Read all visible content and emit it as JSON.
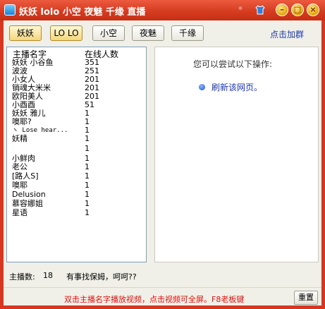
{
  "window": {
    "title": "妖妖 lolo 小空 夜魅 千缘 直播",
    "controls": {
      "minimize": "–",
      "maximize": "□",
      "close": "×"
    }
  },
  "tabs": [
    {
      "label": "妖妖",
      "active": true
    },
    {
      "label": "LO LO",
      "active": true
    },
    {
      "label": "小空",
      "active": false
    },
    {
      "label": "夜魅",
      "active": false
    },
    {
      "label": "千缘",
      "active": false
    }
  ],
  "top_link": "点击加群",
  "list": {
    "headers": {
      "name": "主播名字",
      "count": "在线人数"
    },
    "rows": [
      {
        "name": "妖妖 小谷鱼",
        "count": "351"
      },
      {
        "name": "波波",
        "count": "251"
      },
      {
        "name": "小女人",
        "count": "201"
      },
      {
        "name": "销魂大米米",
        "count": "201"
      },
      {
        "name": "欧阳美人",
        "count": "201"
      },
      {
        "name": "小酉酉",
        "count": "51"
      },
      {
        "name": "妖妖 雅儿",
        "count": "1"
      },
      {
        "name": "噢耶?",
        "count": "1"
      },
      {
        "name": "ヽ Lose hear...",
        "count": "1"
      },
      {
        "name": "妖精",
        "count": "1"
      },
      {
        "name": "",
        "count": "1"
      },
      {
        "name": "小鲜肉",
        "count": "1"
      },
      {
        "name": "老公",
        "count": "1"
      },
      {
        "name": "[路人S]",
        "count": "1"
      },
      {
        "name": "噢耶",
        "count": "1"
      },
      {
        "name": "Delusion",
        "count": "1"
      },
      {
        "name": "慕容娜姐",
        "count": "1"
      },
      {
        "name": "星语",
        "count": "1"
      }
    ]
  },
  "right_panel": {
    "message": "您可以尝试以下操作:",
    "link": "刷新该网页。"
  },
  "status": {
    "label": "主播数:",
    "value": "18",
    "tip": "有事找保姆，呵呵??"
  },
  "bottom": {
    "notice": "双击主播名字播放视频，点击视频可全屏。F8老板键",
    "reset_button": "重置"
  },
  "colors": {
    "titlebar": "#d33a1e",
    "link": "#1a37b0",
    "notice": "#dd1111"
  },
  "icons": [
    "app-icon",
    "shirt-icon",
    "minimize-icon",
    "maximize-icon",
    "close-icon",
    "bullet-icon"
  ]
}
